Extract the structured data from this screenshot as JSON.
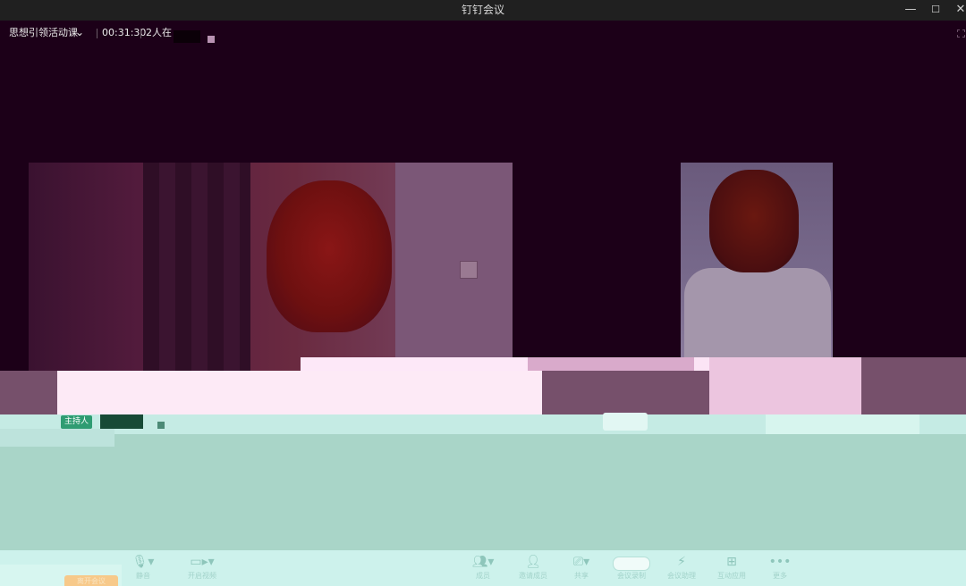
{
  "window": {
    "title": "钉钉会议",
    "minimize_glyph": "—",
    "maximize_glyph": "☐",
    "close_glyph": "✕"
  },
  "meeting": {
    "name": "思想引领活动课",
    "duration": "00:31:30",
    "participants_text": "2人在"
  },
  "host_badge": "主持人",
  "toolbar": {
    "mic_label": "静音",
    "camera_label": "开启视频",
    "participants_label": "成员",
    "invite_label": "邀请成员",
    "share_label": "共享",
    "record_label": "会议录制",
    "ai_label": "会议助理",
    "apps_label": "互动应用",
    "more_label": "更多",
    "leave_label": "离开会议"
  },
  "icons": {
    "mic": "microphone-icon",
    "camera": "camera-icon",
    "participants": "participants-icon",
    "invite": "add-person-icon",
    "share": "screen-share-icon",
    "ai": "lightning-icon",
    "apps": "grid-icon",
    "more": "ellipsis-icon",
    "chevron": "chevron-down-icon"
  },
  "colors": {
    "titlebar": "#202020",
    "background": "#1c0018",
    "host_badge": "#2f9c72",
    "toolbar": "#cdf2ec",
    "leave": "#f7c98a"
  }
}
